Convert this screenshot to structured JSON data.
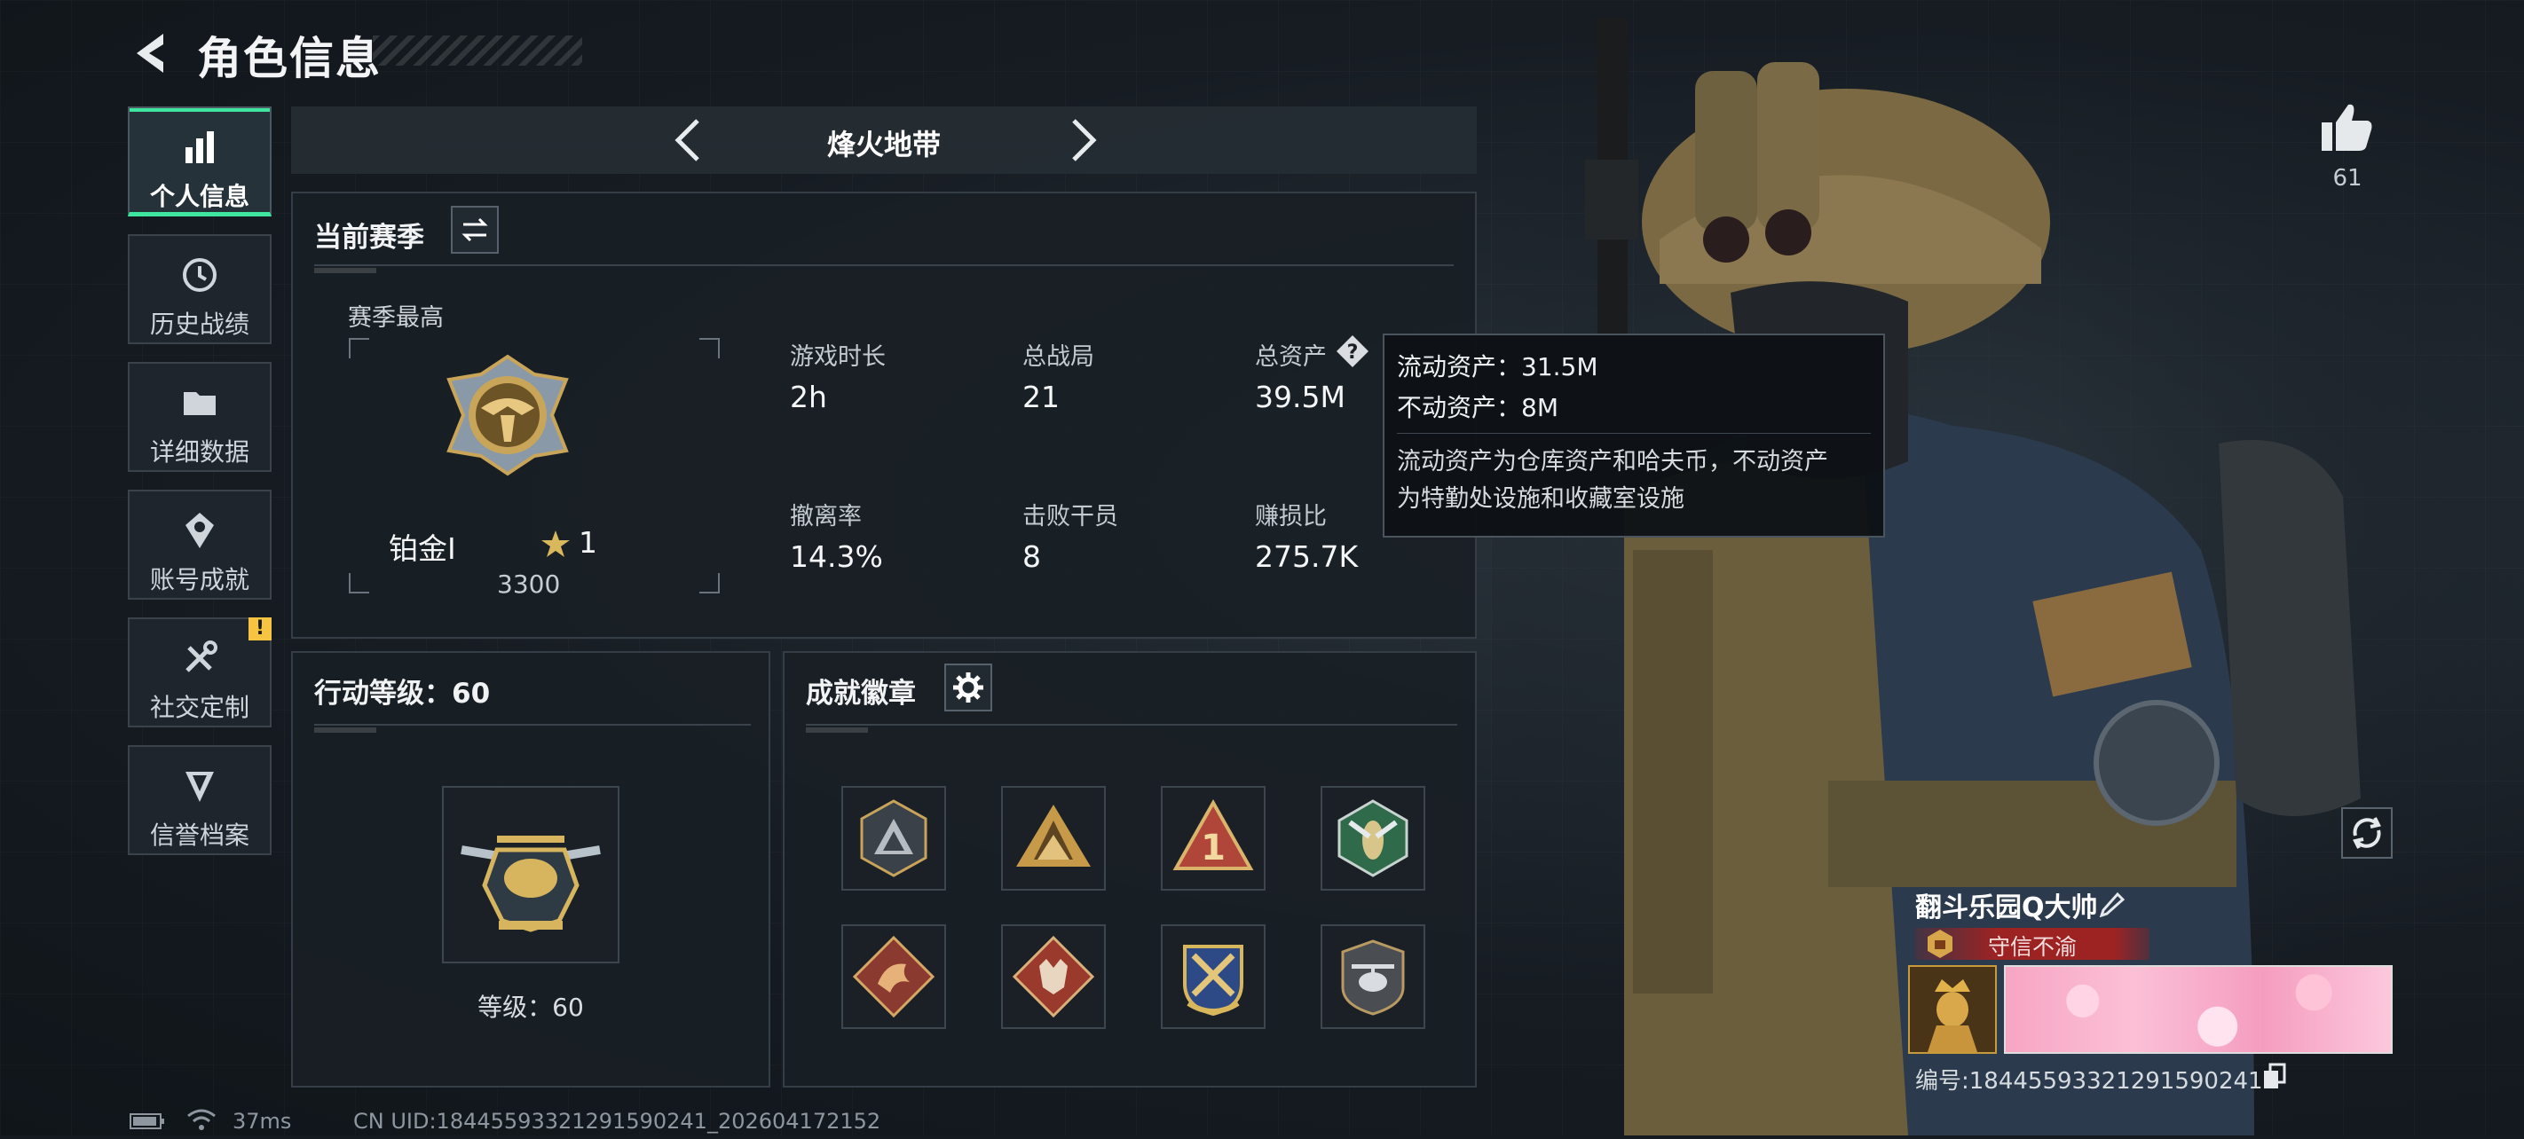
{
  "header": {
    "title": "角色信息"
  },
  "sidebar": {
    "items": [
      {
        "label": "个人信息",
        "icon": "bar-chart-icon",
        "active": true
      },
      {
        "label": "历史战绩",
        "icon": "history-clock-icon"
      },
      {
        "label": "详细数据",
        "icon": "folder-icon"
      },
      {
        "label": "账号成就",
        "icon": "achievement-icon"
      },
      {
        "label": "社交定制",
        "icon": "tools-icon",
        "badge": "!"
      },
      {
        "label": "信誉档案",
        "icon": "credit-shield-icon"
      }
    ]
  },
  "mode": {
    "title": "烽火地带"
  },
  "season": {
    "title": "当前赛季",
    "best_label": "赛季最高",
    "rank_name": "铂金Ⅰ",
    "rank_stars": "1",
    "rank_points": "3300",
    "stats": [
      {
        "label": "游戏时长",
        "value": "2h"
      },
      {
        "label": "总战局",
        "value": "21"
      },
      {
        "label": "总资产",
        "value": "39.5M"
      },
      {
        "label": "撤离率",
        "value": "14.3%"
      },
      {
        "label": "击败干员",
        "value": "8"
      },
      {
        "label": "赚损比",
        "value": "275.7K"
      }
    ]
  },
  "tooltip": {
    "liquid": "流动资产：31.5M",
    "fixed": "不动资产：8M",
    "desc1": "流动资产为仓库资产和哈夫币，不动资产",
    "desc2": "为特勤处设施和收藏室设施"
  },
  "action_level": {
    "title": "行动等级：60",
    "level_text": "等级：60"
  },
  "achievements": {
    "title": "成就徽章",
    "badges": [
      "triangle-badge",
      "mountain-badge",
      "number-one-badge",
      "wasp-badge",
      "dragon-badge",
      "wolf-badge",
      "crossed-weapons-badge",
      "helicopter-badge"
    ]
  },
  "player": {
    "likes": "61",
    "name": "翻斗乐园Q大帅",
    "honor": "守信不渝",
    "id_text": "编号:18445593321291590241"
  },
  "status_bar": {
    "ping": "37ms",
    "uid": "CN UID:18445593321291590241_202604172152"
  },
  "colors": {
    "accent": "#3ee6a0",
    "honor_red": "#9d2323",
    "notice_yellow": "#f5c542"
  }
}
